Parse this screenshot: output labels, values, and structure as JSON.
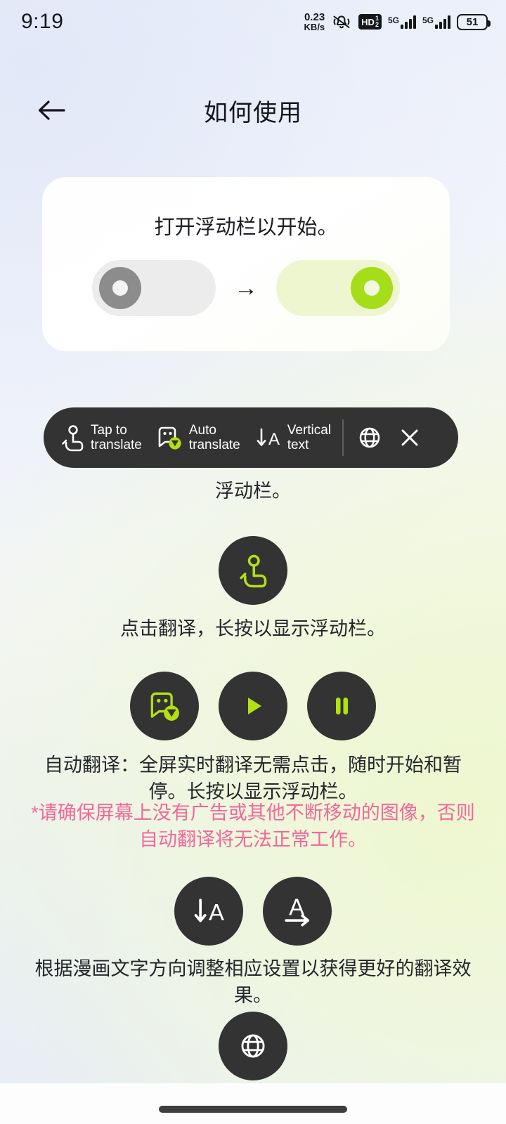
{
  "status_bar": {
    "time": "9:19",
    "net_speed_value": "0.23",
    "net_speed_unit": "KB/s",
    "mute_icon": "bell-muted-icon",
    "hd_label": "HD",
    "hd_sub": "1\n2",
    "sim1_network": "5G",
    "sim2_network": "5G",
    "battery_level": "51"
  },
  "header": {
    "back_icon": "back-arrow-icon",
    "title": "如何使用"
  },
  "toggle_card": {
    "title": "打开浮动栏以开始。",
    "switch_off_state": "off",
    "switch_on_state": "on",
    "arrow": "→",
    "colors": {
      "accent_green": "#a5dd18",
      "track_on": "#edf6cf",
      "track_off": "#ececec",
      "knob_off": "#8c8c8c"
    }
  },
  "floating_bar": {
    "items": [
      {
        "icon": "tap-hand-icon",
        "label_line1": "Tap to",
        "label_line2": "translate"
      },
      {
        "icon": "auto-translate-icon",
        "label_line1": "Auto",
        "label_line2": "translate"
      },
      {
        "icon": "vertical-text-icon",
        "label_line1": "Vertical",
        "label_line2": "text"
      }
    ],
    "globe_icon": "globe-icon",
    "close_icon": "close-icon",
    "caption": "浮动栏。"
  },
  "sections": [
    {
      "buttons": [
        {
          "icon": "tap-hand-icon",
          "style": "green"
        }
      ],
      "caption": "点击翻译，长按以显示浮动栏。"
    },
    {
      "buttons": [
        {
          "icon": "auto-translate-icon",
          "style": "green"
        },
        {
          "icon": "play-icon",
          "style": "green"
        },
        {
          "icon": "pause-icon",
          "style": "green"
        }
      ],
      "caption": "自动翻译：全屏实时翻译无需点击，随时开始和暂停。长按以显示浮动栏。",
      "warning": "*请确保屏幕上没有广告或其他不断移动的图像，否则自动翻译将无法正常工作。"
    },
    {
      "buttons": [
        {
          "icon": "vertical-text-icon",
          "style": "white"
        },
        {
          "icon": "horizontal-text-icon",
          "style": "white"
        }
      ],
      "caption": "根据漫画文字方向调整相应设置以获得更好的翻译效果。"
    },
    {
      "buttons": [
        {
          "icon": "globe-icon",
          "style": "white"
        }
      ],
      "caption": ""
    }
  ],
  "home_indicator": "home-indicator-bar"
}
